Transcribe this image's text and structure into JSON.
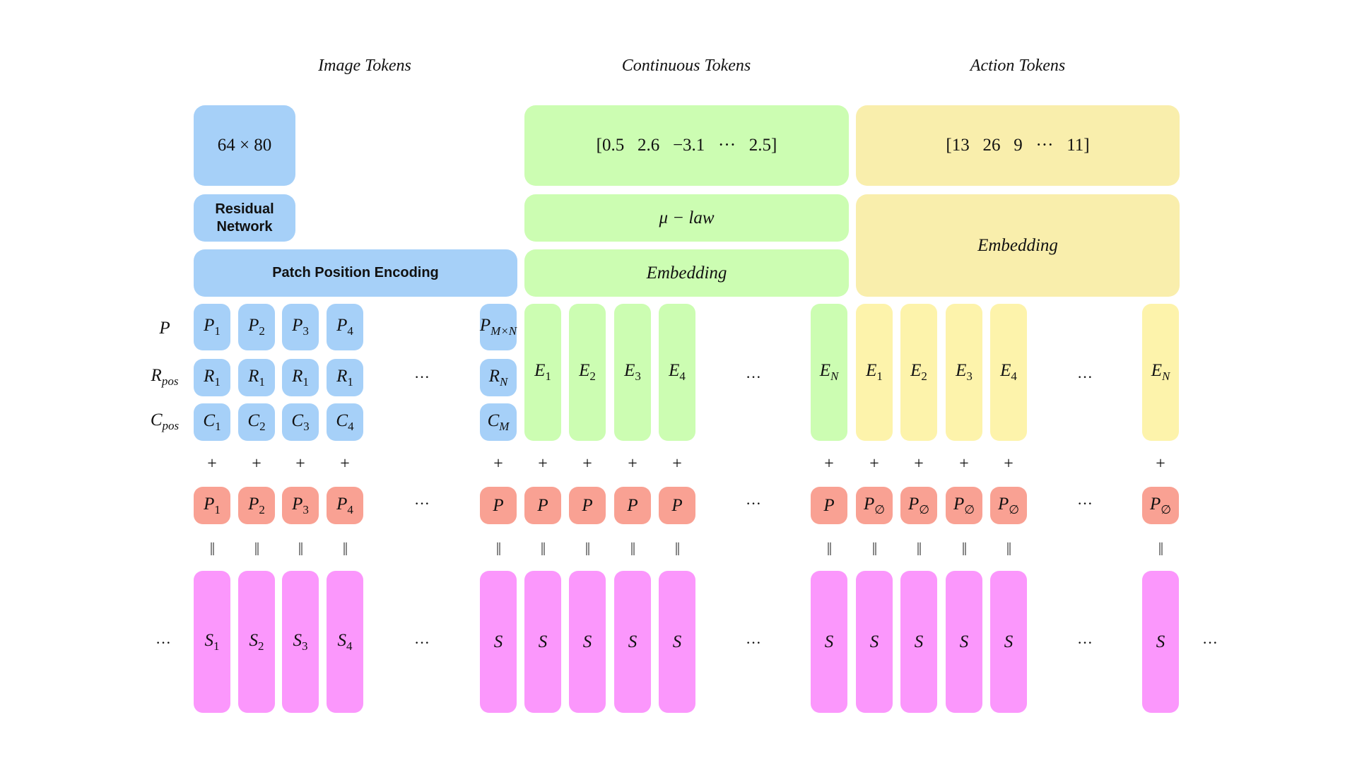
{
  "headers": {
    "image": "Image Tokens",
    "continuous": "Continuous Tokens",
    "action": "Action Tokens"
  },
  "image_section": {
    "input_size": "64 × 80",
    "residual_network": [
      "Residual",
      "Network"
    ],
    "patch_position_encoding": "Patch Position Encoding",
    "row_labels": {
      "p": {
        "base": "P",
        "sub": ""
      },
      "r": {
        "base": "R",
        "sub": "pos"
      },
      "c": {
        "base": "C",
        "sub": "pos"
      }
    },
    "patches": [
      {
        "p": {
          "base": "P",
          "sub": "1"
        },
        "r": {
          "base": "R",
          "sub": "1"
        },
        "c": {
          "base": "C",
          "sub": "1"
        },
        "pos": {
          "base": "P",
          "sub": "1"
        },
        "s": {
          "base": "S",
          "sub": "1"
        }
      },
      {
        "p": {
          "base": "P",
          "sub": "2"
        },
        "r": {
          "base": "R",
          "sub": "1"
        },
        "c": {
          "base": "C",
          "sub": "2"
        },
        "pos": {
          "base": "P",
          "sub": "2"
        },
        "s": {
          "base": "S",
          "sub": "2"
        }
      },
      {
        "p": {
          "base": "P",
          "sub": "3"
        },
        "r": {
          "base": "R",
          "sub": "1"
        },
        "c": {
          "base": "C",
          "sub": "3"
        },
        "pos": {
          "base": "P",
          "sub": "3"
        },
        "s": {
          "base": "S",
          "sub": "3"
        }
      },
      {
        "p": {
          "base": "P",
          "sub": "4"
        },
        "r": {
          "base": "R",
          "sub": "1"
        },
        "c": {
          "base": "C",
          "sub": "4"
        },
        "pos": {
          "base": "P",
          "sub": "4"
        },
        "s": {
          "base": "S",
          "sub": "4"
        }
      }
    ],
    "last_patch": {
      "p": {
        "base": "P",
        "sub": "M×N"
      },
      "r": {
        "base": "R",
        "sub": "N"
      },
      "c": {
        "base": "C",
        "sub": "M"
      },
      "pos": {
        "base": "P",
        "sub": ""
      },
      "s": {
        "base": "S",
        "sub": ""
      }
    }
  },
  "continuous_section": {
    "values": "[0.5   2.6   −3.1   ···   2.5]",
    "mu_law": "μ − law",
    "embedding": "Embedding",
    "tokens": [
      {
        "e": {
          "base": "E",
          "sub": "1"
        },
        "pos": {
          "base": "P",
          "sub": ""
        },
        "s": {
          "base": "S",
          "sub": ""
        }
      },
      {
        "e": {
          "base": "E",
          "sub": "2"
        },
        "pos": {
          "base": "P",
          "sub": ""
        },
        "s": {
          "base": "S",
          "sub": ""
        }
      },
      {
        "e": {
          "base": "E",
          "sub": "3"
        },
        "pos": {
          "base": "P",
          "sub": ""
        },
        "s": {
          "base": "S",
          "sub": ""
        }
      },
      {
        "e": {
          "base": "E",
          "sub": "4"
        },
        "pos": {
          "base": "P",
          "sub": ""
        },
        "s": {
          "base": "S",
          "sub": ""
        }
      }
    ],
    "last_token": {
      "e": {
        "base": "E",
        "sub": "N"
      },
      "pos": {
        "base": "P",
        "sub": ""
      },
      "s": {
        "base": "S",
        "sub": ""
      }
    }
  },
  "action_section": {
    "values": "[13   26   9   ···   11]",
    "embedding": "Embedding",
    "tokens": [
      {
        "e": {
          "base": "E",
          "sub": "1"
        },
        "pos": {
          "base": "P",
          "sub": "∅"
        },
        "s": {
          "base": "S",
          "sub": ""
        }
      },
      {
        "e": {
          "base": "E",
          "sub": "2"
        },
        "pos": {
          "base": "P",
          "sub": "∅"
        },
        "s": {
          "base": "S",
          "sub": ""
        }
      },
      {
        "e": {
          "base": "E",
          "sub": "3"
        },
        "pos": {
          "base": "P",
          "sub": "∅"
        },
        "s": {
          "base": "S",
          "sub": ""
        }
      },
      {
        "e": {
          "base": "E",
          "sub": "4"
        },
        "pos": {
          "base": "P",
          "sub": "∅"
        },
        "s": {
          "base": "S",
          "sub": ""
        }
      }
    ],
    "last_token": {
      "e": {
        "base": "E",
        "sub": "N"
      },
      "pos": {
        "base": "P",
        "sub": "∅"
      },
      "s": {
        "base": "S",
        "sub": ""
      }
    }
  },
  "symbols": {
    "plus": "+",
    "equals": "॥",
    "ellipsis": "···"
  },
  "colors": {
    "image": "#a6d0f8",
    "continuous": "#ccfdb2",
    "action": "#f9eeac",
    "action_token": "#fdf3ab",
    "position": "#f9a193",
    "sequence": "#fb97fc"
  }
}
